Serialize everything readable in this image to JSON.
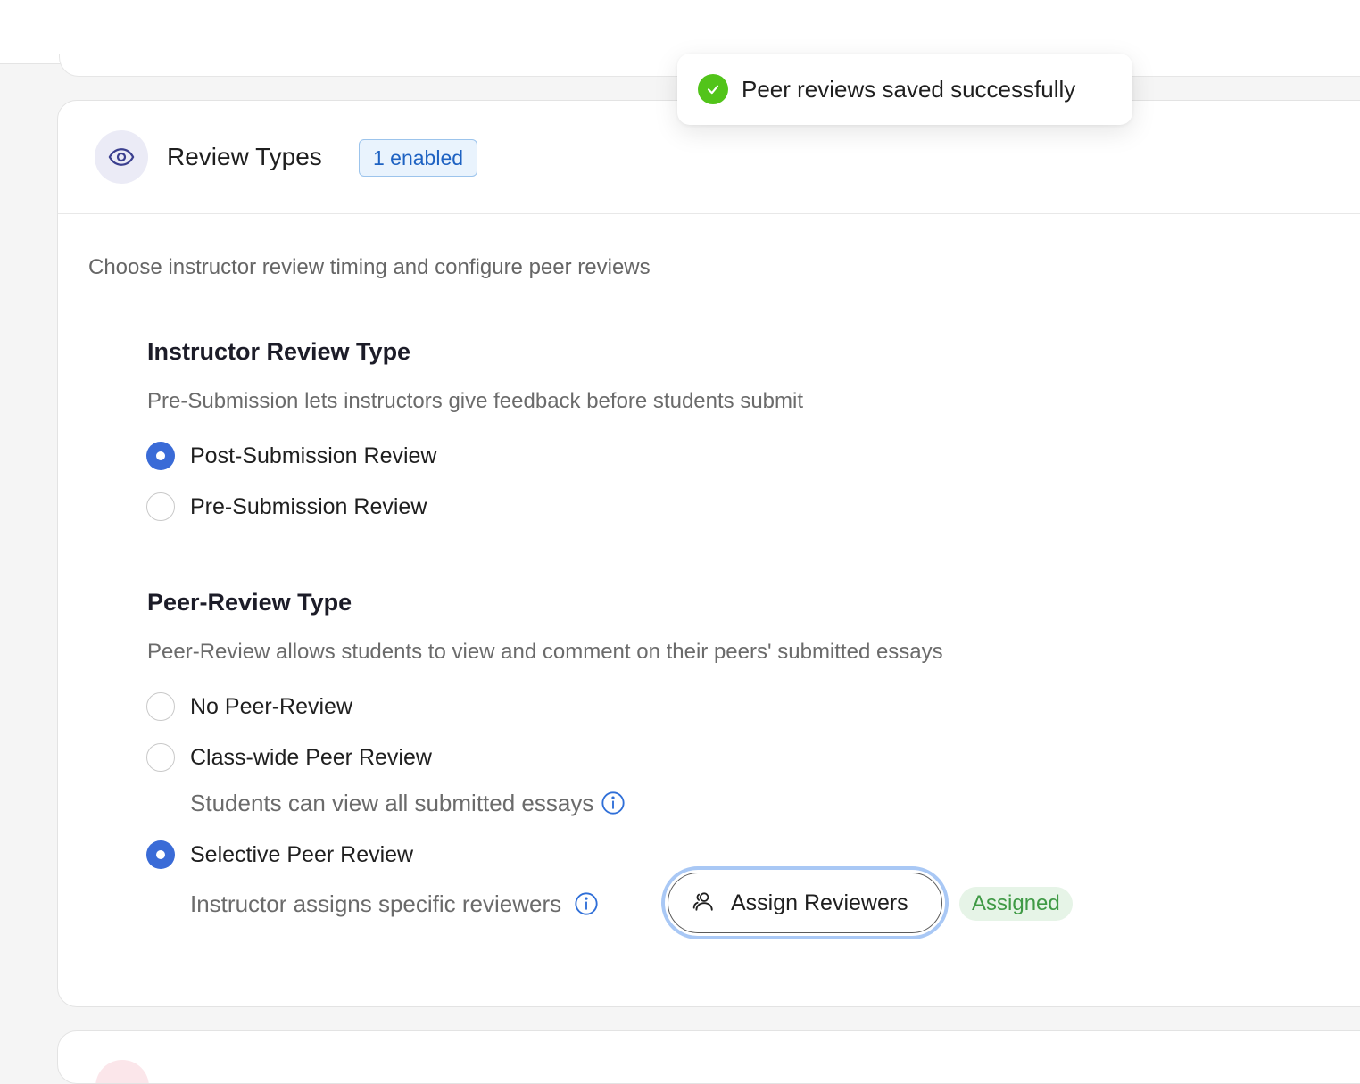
{
  "toast": {
    "message": "Peer reviews saved successfully",
    "icon": "check-circle-icon",
    "color": "#52c41a"
  },
  "card": {
    "title": "Review Types",
    "icon": "eye-icon",
    "badge": "1 enabled",
    "description": "Choose instructor review timing and configure peer reviews"
  },
  "instructor_review": {
    "title": "Instructor Review Type",
    "subtitle": "Pre-Submission lets instructors give feedback before students submit",
    "options": [
      {
        "label": "Post-Submission Review",
        "checked": true
      },
      {
        "label": "Pre-Submission Review",
        "checked": false
      }
    ]
  },
  "peer_review": {
    "title": "Peer-Review Type",
    "subtitle": "Peer-Review allows students to view and comment on their peers' submitted essays",
    "options": [
      {
        "label": "No Peer-Review",
        "checked": false
      },
      {
        "label": "Class-wide Peer Review",
        "checked": false,
        "description": "Students can view all submitted essays"
      },
      {
        "label": "Selective Peer Review",
        "checked": true,
        "description": "Instructor assigns specific reviewers"
      }
    ],
    "assign_button": {
      "label": "Assign Reviewers",
      "icon": "users-icon"
    },
    "status": "Assigned"
  },
  "colors": {
    "accent": "#3a6bd7",
    "badge_text": "#1e62c2",
    "success": "#3f9a45"
  }
}
